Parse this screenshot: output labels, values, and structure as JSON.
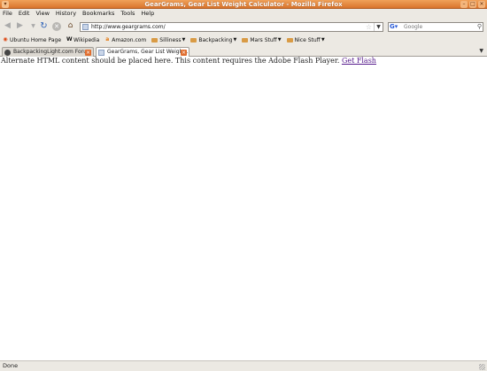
{
  "window": {
    "title": "GearGrams, Gear List Weight Calculator - Mozilla Firefox"
  },
  "menu": {
    "items": [
      "File",
      "Edit",
      "View",
      "History",
      "Bookmarks",
      "Tools",
      "Help"
    ]
  },
  "nav": {
    "url": "http://www.geargrams.com/",
    "search_placeholder": "Google"
  },
  "bookmarks": [
    {
      "label": "Ubuntu Home Page",
      "icon": "ubuntu-icon"
    },
    {
      "label": "Wikipedia",
      "icon": "wikipedia-icon"
    },
    {
      "label": "Amazon.com",
      "icon": "amazon-icon"
    },
    {
      "label": "Silliness",
      "icon": "folder-icon"
    },
    {
      "label": "Backpacking",
      "icon": "folder-icon"
    },
    {
      "label": "Mars Stuff",
      "icon": "folder-icon"
    },
    {
      "label": "Nice Stuff",
      "icon": "folder-icon"
    }
  ],
  "tabs": [
    {
      "label": "BackpackingLight.com Foru...",
      "active": false
    },
    {
      "label": "GearGrams, Gear List Weigh...",
      "active": true
    }
  ],
  "content": {
    "message": "Alternate HTML content should be placed here. This content requires the Adobe Flash Player.",
    "link": "Get Flash"
  },
  "status": {
    "text": "Done"
  }
}
